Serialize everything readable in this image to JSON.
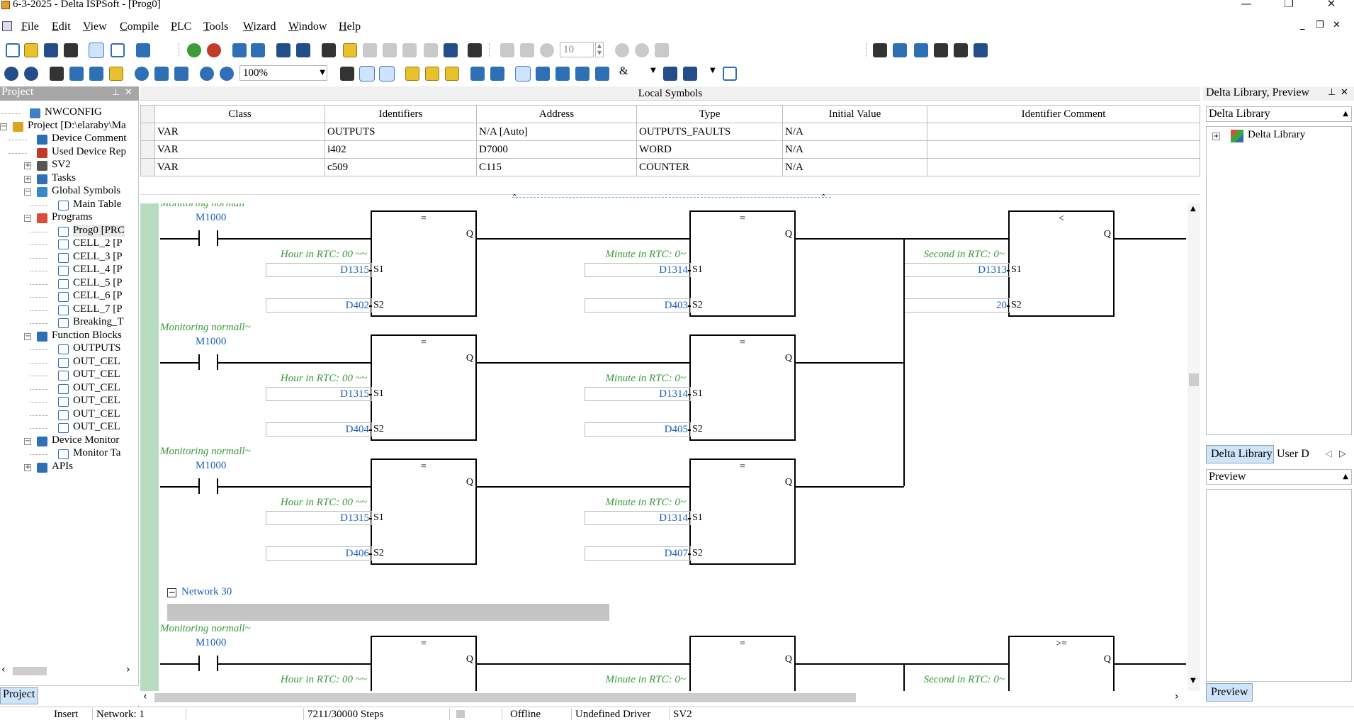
{
  "window": {
    "title": "6-3-2025 - Delta ISPSoft - [Prog0]",
    "minimize_icon": "minimize-icon",
    "restore_icon": "restore-icon",
    "close_icon": "close-icon"
  },
  "menu": [
    "File",
    "Edit",
    "View",
    "Compile",
    "PLC",
    "Tools",
    "Wizard",
    "Window",
    "Help"
  ],
  "toolbar": {
    "step_value": "10",
    "zoom": "100%"
  },
  "project_panel": {
    "title": "Project",
    "tab": "Project",
    "tree": [
      {
        "label": "NWCONFIG",
        "icon": "network-config-icon",
        "level": 1,
        "expander": ""
      },
      {
        "label": "Project [D:\\elaraby\\Ma",
        "icon": "project-icon",
        "level": 0,
        "expander": "−"
      },
      {
        "label": "Device Comment",
        "icon": "comment-icon",
        "level": 2,
        "expander": ""
      },
      {
        "label": "Used Device Rep",
        "icon": "report-icon",
        "level": 2,
        "expander": ""
      },
      {
        "label": "SV2",
        "icon": "plc-icon",
        "level": 2,
        "expander": "+"
      },
      {
        "label": "Tasks",
        "icon": "tasks-icon",
        "level": 2,
        "expander": "+"
      },
      {
        "label": "Global Symbols",
        "icon": "symbols-icon",
        "level": 2,
        "expander": "−"
      },
      {
        "label": "Main Table",
        "icon": "table-icon",
        "level": 3,
        "expander": ""
      },
      {
        "label": "Programs",
        "icon": "programs-icon",
        "level": 2,
        "expander": "−"
      },
      {
        "label": "Prog0 [PRC",
        "icon": "program-icon",
        "level": 3,
        "expander": ""
      },
      {
        "label": "CELL_2 [P",
        "icon": "program-icon",
        "level": 3,
        "expander": ""
      },
      {
        "label": "CELL_3 [P",
        "icon": "program-icon",
        "level": 3,
        "expander": ""
      },
      {
        "label": "CELL_4 [P",
        "icon": "program-icon",
        "level": 3,
        "expander": ""
      },
      {
        "label": "CELL_5 [P",
        "icon": "program-icon",
        "level": 3,
        "expander": ""
      },
      {
        "label": "CELL_6 [P",
        "icon": "program-icon",
        "level": 3,
        "expander": ""
      },
      {
        "label": "CELL_7 [P",
        "icon": "program-icon",
        "level": 3,
        "expander": ""
      },
      {
        "label": "Breaking_T",
        "icon": "program-icon",
        "level": 3,
        "expander": ""
      },
      {
        "label": "Function Blocks",
        "icon": "function-blocks-icon",
        "level": 2,
        "expander": "−"
      },
      {
        "label": "OUTPUTS",
        "icon": "function-block-icon",
        "level": 3,
        "expander": ""
      },
      {
        "label": "OUT_CEL",
        "icon": "function-block-icon",
        "level": 3,
        "expander": ""
      },
      {
        "label": "OUT_CEL",
        "icon": "function-block-icon",
        "level": 3,
        "expander": ""
      },
      {
        "label": "OUT_CEL",
        "icon": "function-block-icon",
        "level": 3,
        "expander": ""
      },
      {
        "label": "OUT_CEL",
        "icon": "function-block-icon",
        "level": 3,
        "expander": ""
      },
      {
        "label": "OUT_CEL",
        "icon": "function-block-icon",
        "level": 3,
        "expander": ""
      },
      {
        "label": "OUT_CEL",
        "icon": "function-block-icon",
        "level": 3,
        "expander": ""
      },
      {
        "label": "Device Monitor",
        "icon": "monitor-icon",
        "level": 2,
        "expander": "−"
      },
      {
        "label": "Monitor Ta",
        "icon": "monitor-table-icon",
        "level": 3,
        "expander": ""
      },
      {
        "label": "APIs",
        "icon": "apis-icon",
        "level": 2,
        "expander": "+"
      }
    ]
  },
  "local_symbols": {
    "title": "Local Symbols",
    "columns": [
      "Class",
      "Identifiers",
      "Address",
      "Type",
      "Initial Value",
      "Identifier Comment"
    ],
    "rows": [
      [
        "VAR",
        "OUTPUTS",
        "N/A [Auto]",
        "OUTPUTS_FAULTS",
        "N/A",
        ""
      ],
      [
        "VAR",
        "i402",
        "D7000",
        "WORD",
        "N/A",
        ""
      ],
      [
        "VAR",
        "c509",
        "C115",
        "COUNTER",
        "N/A",
        ""
      ]
    ]
  },
  "ladder": {
    "rungs": [
      {
        "comment": "Monitoring normall~",
        "contact": "M1000",
        "blocks": [
          {
            "op": "=",
            "comment": "Hour in RTC: 00 ~~",
            "s1": "D1315",
            "s2": "D402"
          },
          {
            "op": "=",
            "comment": "Minute in RTC: 0~",
            "s1": "D1314",
            "s2": "D403"
          },
          {
            "op": "<",
            "comment": "Second in RTC: 0~",
            "s1": "D1313",
            "s2": "20"
          }
        ]
      },
      {
        "comment": "Monitoring normall~",
        "contact": "M1000",
        "blocks": [
          {
            "op": "=",
            "comment": "Hour in RTC: 00 ~~",
            "s1": "D1315",
            "s2": "D404"
          },
          {
            "op": "=",
            "comment": "Minute in RTC: 0~",
            "s1": "D1314",
            "s2": "D405"
          }
        ]
      },
      {
        "comment": "Monitoring normall~",
        "contact": "M1000",
        "blocks": [
          {
            "op": "=",
            "comment": "Hour in RTC: 00 ~~",
            "s1": "D1315",
            "s2": "D406"
          },
          {
            "op": "=",
            "comment": "Minute in RTC: 0~",
            "s1": "D1314",
            "s2": "D407"
          }
        ]
      },
      {
        "comment": "Monitoring normall~",
        "contact": "M1000",
        "blocks": [
          {
            "op": "=",
            "comment": "Hour in RTC: 00 ~~",
            "s1": "",
            "s2": ""
          },
          {
            "op": "=",
            "comment": "Minute in RTC: 0~",
            "s1": "",
            "s2": ""
          },
          {
            "op": ">=",
            "comment": "Second in RTC: 0~",
            "s1": "",
            "s2": ""
          }
        ]
      }
    ],
    "pin_q": "Q",
    "pin_s1": "S1",
    "pin_s2": "S2",
    "network_label": "Network 30"
  },
  "right_panel": {
    "title": "Delta Library, Preview",
    "library_section": "Delta Library",
    "library_root": "Delta Library",
    "tab_active": "Delta Library",
    "tab_other": "User D",
    "preview_section": "Preview",
    "preview_tab": "Preview"
  },
  "status": {
    "mode": "Insert",
    "network": "Network: 1",
    "steps": "7211/30000 Steps",
    "connection": "Offline",
    "driver": "Undefined Driver",
    "plc": "SV2"
  },
  "colors": {
    "comment_green": "#3a9a3a",
    "device_blue": "#1c5fbf",
    "gutter_green": "#b8dcc0",
    "selected_tab": "#cfe3fb"
  }
}
